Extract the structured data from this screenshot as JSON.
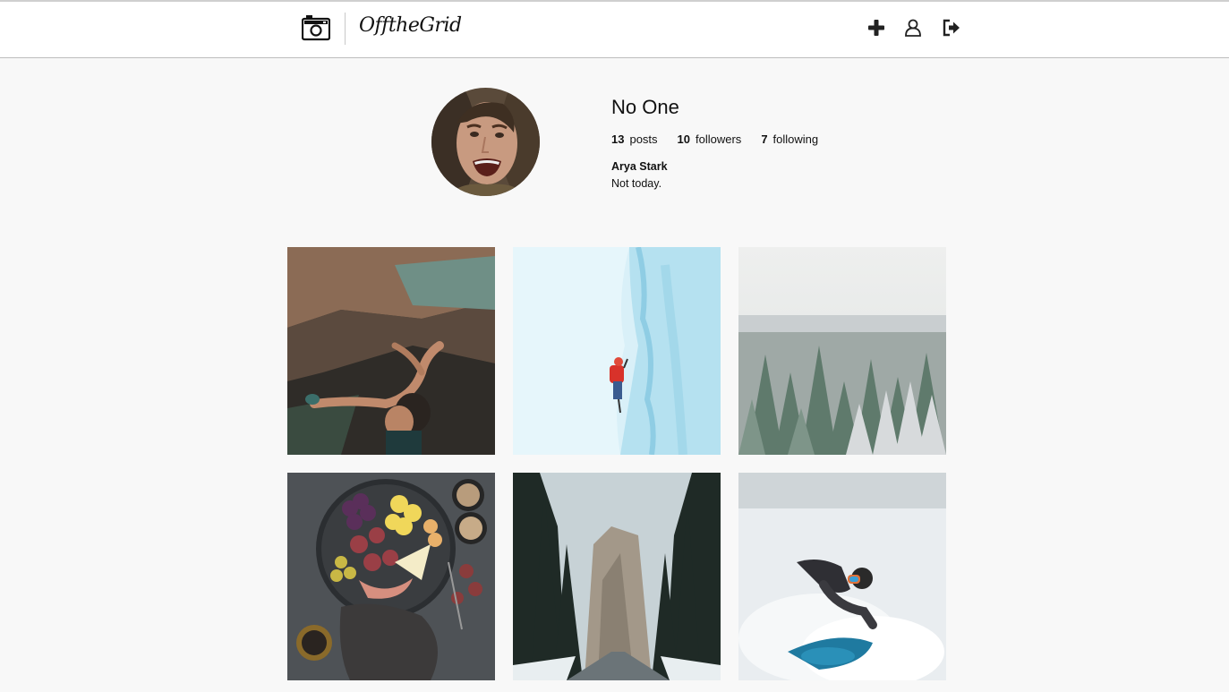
{
  "header": {
    "logo_text": "OfftheGrid",
    "icons": [
      "camera-icon",
      "plus-icon",
      "user-icon",
      "logout-icon"
    ]
  },
  "profile": {
    "username": "No One",
    "stats": {
      "posts_count": "13",
      "posts_label": "posts",
      "followers_count": "10",
      "followers_label": "followers",
      "following_count": "7",
      "following_label": "following"
    },
    "full_name": "Arya Stark",
    "bio": "Not today."
  },
  "posts": [
    {
      "subject": "rock-climber"
    },
    {
      "subject": "ice-climber"
    },
    {
      "subject": "frosted-forest"
    },
    {
      "subject": "food-platter"
    },
    {
      "subject": "snowy-road-cliff"
    },
    {
      "subject": "snowboarder"
    }
  ],
  "colors": {
    "background": "#f8f8f8",
    "header_bg": "#ffffff",
    "text": "#111111"
  }
}
